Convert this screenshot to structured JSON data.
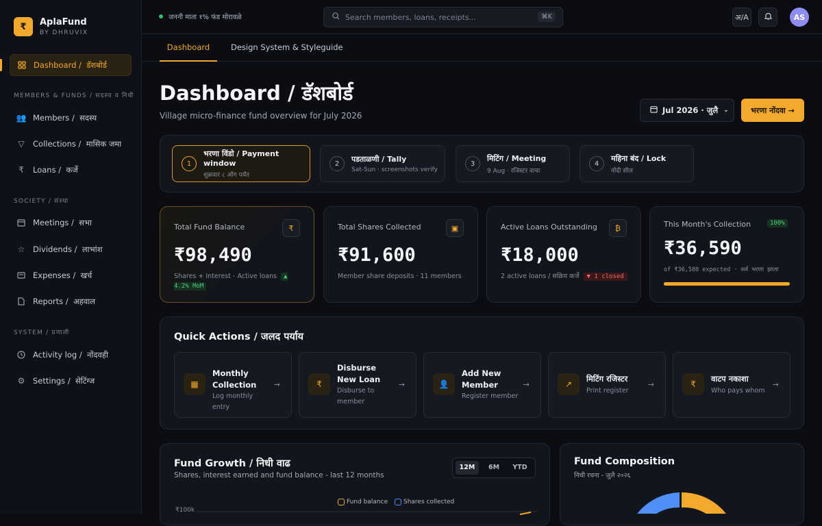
{
  "app": {
    "logo_glyph": "₹",
    "name": "AplaFund",
    "byline": "BY DHRUVIX",
    "accent": "#f2a92c"
  },
  "sidebar": {
    "sections": [
      "MEMBERS & FUNDS / सदस्य व निधी",
      "SOCIETY / संस्था",
      "SYSTEM / प्रणाली"
    ],
    "items": [
      {
        "label": "Dashboard /",
        "local": "डॅशबोर्ड",
        "icon": "grid-icon"
      },
      {
        "label": "Members /",
        "local": "सदस्य",
        "icon": "users-icon"
      },
      {
        "label": "Collections /",
        "local": "मासिक जमा",
        "icon": "trophy-icon"
      },
      {
        "label": "Loans /",
        "local": "कर्जे",
        "icon": "rupee-icon"
      },
      {
        "label": "Meetings /",
        "local": "सभा",
        "icon": "calendar-icon"
      },
      {
        "label": "Dividends /",
        "local": "लाभांश",
        "icon": "star-icon"
      },
      {
        "label": "Expenses /",
        "local": "खर्च",
        "icon": "receipt-icon"
      },
      {
        "label": "Reports /",
        "local": "अहवाल",
        "icon": "doc-icon"
      },
      {
        "label": "Activity log /",
        "local": "नोंदवही",
        "icon": "clock-icon"
      },
      {
        "label": "Settings /",
        "local": "सेटिंग्ज",
        "icon": "gear-icon"
      }
    ]
  },
  "topbar": {
    "motto": "जननी माता १% फंड मोरावळे",
    "search_placeholder": "Search members, loans, receipts...",
    "search_shortcut": "⌘K",
    "lang_toggle": "अ/A",
    "avatar_initials": "AS"
  },
  "tabs": [
    "Dashboard",
    "Design System & Styleguide"
  ],
  "page": {
    "title": "Dashboard / डॅशबोर्ड",
    "subtitle": "Village micro-finance fund overview for July 2026",
    "month_label": "Jul 2026 · जुलै",
    "primary_action": "भरणा नोंदवा →"
  },
  "steps": [
    {
      "num": "1",
      "title": "भरणा विंडो / Payment window",
      "sub": "शुक्रवार ८ ऑग पर्यंत"
    },
    {
      "num": "2",
      "title": "पडताळणी / Tally",
      "sub": "Sat-Sun · screenshots verify"
    },
    {
      "num": "3",
      "title": "मिटिंग / Meeting",
      "sub": "9 Aug · रजिस्टर वाचा"
    },
    {
      "num": "4",
      "title": "महिना बंद / Lock",
      "sub": "नोंदी सील"
    }
  ],
  "stats": [
    {
      "label": "Total Fund Balance",
      "icon": "₹",
      "value": "₹98,490",
      "foot": "Shares + Interest - Active loans",
      "badge": "▲ 4.2% MoM"
    },
    {
      "label": "Total Shares Collected",
      "icon": "▣",
      "value": "₹91,600",
      "foot": "Member share deposits · 11 members"
    },
    {
      "label": "Active Loans Outstanding",
      "icon": "₿",
      "value": "₹18,000",
      "foot": "2 active loans / सक्रिय कर्जे",
      "badge": "▼ 1 closed"
    },
    {
      "label": "This Month's Collection",
      "badge": "100%",
      "value": "₹36,590",
      "foot": "of ₹36,580 expected · सर्व भरणा झाला",
      "progress": 1.0
    }
  ],
  "quick_actions": {
    "title": "Quick Actions /  जलद पर्याय",
    "items": [
      {
        "title": "Monthly Collection",
        "sub": "Log monthly entry",
        "icon": "calendar-icon"
      },
      {
        "title": "Disburse New Loan",
        "sub": "Disburse to member",
        "icon": "rupee-icon"
      },
      {
        "title": "Add New Member",
        "sub": "Register member",
        "icon": "user-plus-icon"
      },
      {
        "title": "मिटिंग रजिस्टर",
        "sub": "Print register",
        "icon": "trend-icon"
      },
      {
        "title": "वाटप नकाशा",
        "sub": "Who pays whom",
        "icon": "rupee-icon"
      }
    ]
  },
  "growth": {
    "title": "Fund Growth /  निधी वाढ",
    "subtitle": "Shares, interest earned and fund balance - last 12 months",
    "ranges": [
      "12M",
      "6M",
      "YTD"
    ],
    "selected": "12M",
    "legend": [
      "Fund balance",
      "Shares collected"
    ],
    "ytick": "₹100k",
    "colors": [
      "#f2a92c",
      "#4f8ff7"
    ]
  },
  "composition": {
    "title": "Fund Composition",
    "subtitle": "निधी रचना - जुलै २०२६"
  }
}
